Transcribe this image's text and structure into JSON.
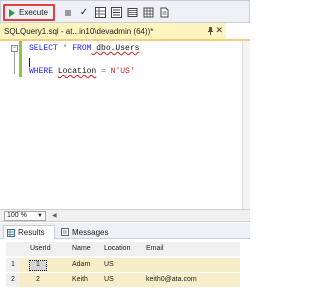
{
  "toolbar": {
    "execute_label": "Execute",
    "icons": [
      "execute-icon",
      "stop-icon",
      "parse-check-icon",
      "display-plan-icon",
      "query-options-icon",
      "results-to-text-icon",
      "results-to-grid-icon",
      "results-to-file-icon"
    ]
  },
  "tab": {
    "title": "SQLQuery1.sql - at...in10\\devadmin (64))*",
    "close_glyph": "✕"
  },
  "editor": {
    "line1": {
      "kw1": "SELECT",
      "op": " * ",
      "kw2": "FROM",
      "obj": " dbo.Users"
    },
    "line2": {
      "kw": "WHERE",
      "col": "Location",
      "op": " = ",
      "str": "N'US'"
    }
  },
  "zoom": {
    "value": "100 %"
  },
  "results_tabs": {
    "results": "Results",
    "messages": "Messages"
  },
  "grid": {
    "columns": [
      "UserId",
      "Name",
      "Location",
      "Email"
    ],
    "rows": [
      {
        "num": "1",
        "userid": "1",
        "name": "Adam",
        "location": "US",
        "email": ""
      },
      {
        "num": "2",
        "userid": "2",
        "name": "Keith",
        "location": "US",
        "email": "keith0@ata.com"
      }
    ]
  },
  "colors": {
    "execute_border": "#e0403b",
    "tab_background": "#fdf4bf",
    "row_background": "#f7edc8",
    "keyword": "#1a1aff",
    "string": "#d42222"
  }
}
